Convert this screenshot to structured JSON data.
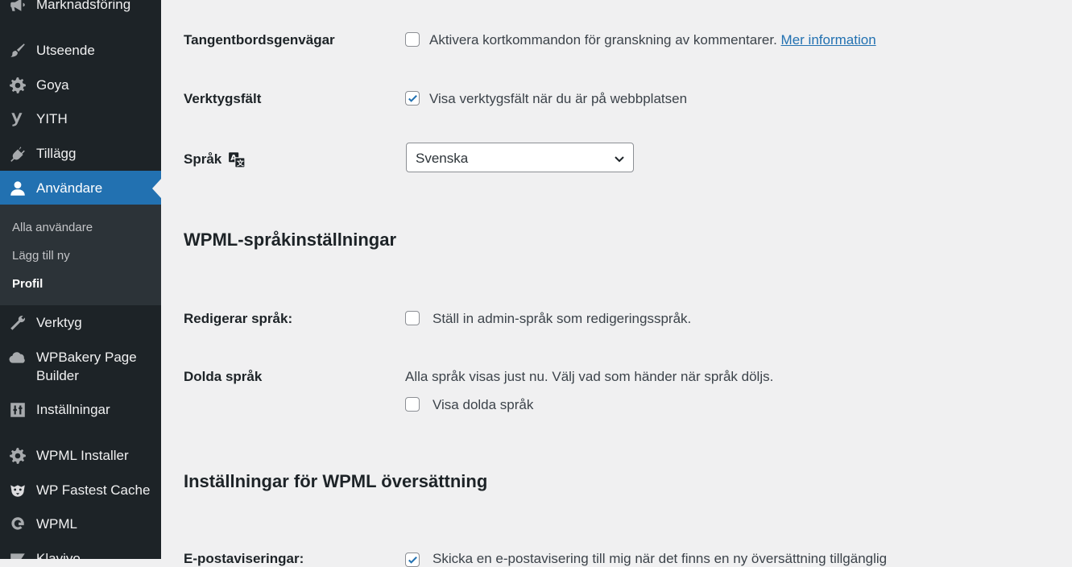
{
  "sidebar": {
    "items": [
      {
        "label": "Marknadsföring",
        "icon": "megaphone-icon"
      },
      {
        "label": "Utseende",
        "icon": "paintbrush-icon"
      },
      {
        "label": "Goya",
        "icon": "gear-icon"
      },
      {
        "label": "YITH",
        "icon": "yith-icon"
      },
      {
        "label": "Tillägg",
        "icon": "plugin-icon"
      },
      {
        "label": "Användare",
        "icon": "user-icon",
        "active": true
      },
      {
        "label": "Verktyg",
        "icon": "wrench-icon"
      },
      {
        "label": "WPBakery Page Builder",
        "icon": "cloud-icon"
      },
      {
        "label": "Inställningar",
        "icon": "settings-sliders-icon"
      },
      {
        "label": "WPML Installer",
        "icon": "gear-icon"
      },
      {
        "label": "WP Fastest Cache",
        "icon": "cheetah-icon"
      },
      {
        "label": "WPML",
        "icon": "wpml-icon"
      },
      {
        "label": "Klaviyo",
        "icon": "klaviyo-icon"
      }
    ],
    "submenu": [
      "Alla användare",
      "Lägg till ny",
      "Profil"
    ]
  },
  "main": {
    "shortcuts": {
      "label": "Tangentbordsgenvägar",
      "checkbox_text": "Aktivera kortkommandon för granskning av kommentarer.",
      "link": "Mer information",
      "checked": false
    },
    "toolbar": {
      "label": "Verktygsfält",
      "checkbox_text": "Visa verktygsfält när du är på webbplatsen",
      "checked": true
    },
    "language": {
      "label": "Språk",
      "selected": "Svenska"
    },
    "wpml_lang_title": "WPML-språkinställningar",
    "editing_lang": {
      "label": "Redigerar språk:",
      "checkbox_text": "Ställ in admin-språk som redigeringsspråk.",
      "checked": false
    },
    "hidden_lang": {
      "label": "Dolda språk",
      "description": "Alla språk visas just nu. Välj vad som händer när språk döljs.",
      "checkbox_text": "Visa dolda språk",
      "checked": false
    },
    "wpml_trans_title": "Inställningar för WPML översättning",
    "email": {
      "label": "E-postaviseringar:",
      "checkbox_text": "Skicka en e-postavisering till mig när det finns en ny översättning tillgänglig",
      "checked": true
    }
  },
  "colors": {
    "sidebar_bg": "#1d2327",
    "submenu_bg": "#2c3338",
    "active_bg": "#2271b1",
    "content_bg": "#f0f0f1",
    "link": "#2271b1"
  }
}
